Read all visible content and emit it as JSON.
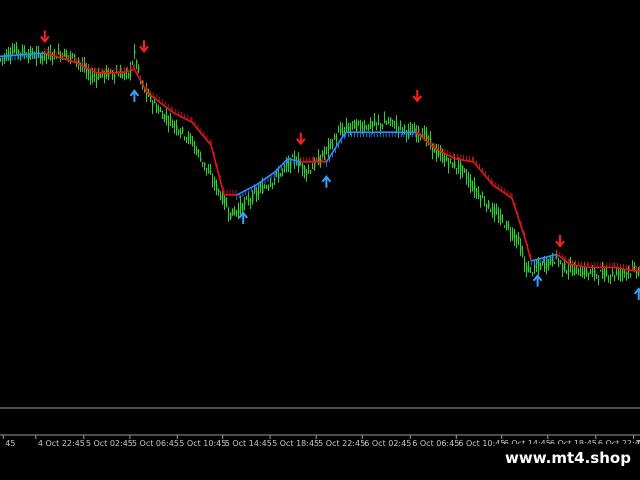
{
  "chart_data": {
    "type": "candlestick",
    "background": "#000000",
    "colors": {
      "candle": "#32cd32",
      "trend_down": "#e8141e",
      "trend_up": "#2a8cff",
      "sell_arrow": "#ff2020",
      "buy_arrow": "#3aa0ff",
      "axis": "#9a9a9a",
      "text": "#c8c8c8"
    },
    "y_range": [
      0,
      100
    ],
    "x_range": [
      0,
      100
    ],
    "x_ticks": [
      {
        "x": 0.5,
        "label": "45"
      },
      {
        "x": 5.6,
        "label": "4 Oct 22:45"
      },
      {
        "x": 13.1,
        "label": "5 Oct 02:45"
      },
      {
        "x": 20.3,
        "label": "5 Oct 06:45"
      },
      {
        "x": 27.7,
        "label": "5 Oct 10:45"
      },
      {
        "x": 34.8,
        "label": "5 Oct 14:45"
      },
      {
        "x": 42.2,
        "label": "5 Oct 18:45"
      },
      {
        "x": 49.4,
        "label": "5 Oct 22:45"
      },
      {
        "x": 56.6,
        "label": "6 Oct 02:45"
      },
      {
        "x": 64.1,
        "label": "6 Oct 06:45"
      },
      {
        "x": 71.3,
        "label": "6 Oct 10:45"
      },
      {
        "x": 78.4,
        "label": "6 Oct 14:45"
      },
      {
        "x": 85.6,
        "label": "6 Oct 18:45"
      },
      {
        "x": 93.1,
        "label": "6 Oct 22:45"
      },
      {
        "x": 99.0,
        "label": "7 Oc"
      }
    ],
    "price_path": [
      [
        0,
        88
      ],
      [
        2,
        91
      ],
      [
        6,
        89
      ],
      [
        10,
        90
      ],
      [
        12,
        88
      ],
      [
        14,
        83
      ],
      [
        18,
        84
      ],
      [
        20,
        83
      ],
      [
        21,
        90
      ],
      [
        22,
        80
      ],
      [
        25,
        72
      ],
      [
        28,
        67
      ],
      [
        30,
        63
      ],
      [
        33,
        52
      ],
      [
        35,
        45
      ],
      [
        36,
        41
      ],
      [
        38,
        44
      ],
      [
        41,
        49
      ],
      [
        44,
        54
      ],
      [
        46,
        58
      ],
      [
        48,
        54
      ],
      [
        50,
        58
      ],
      [
        53,
        66
      ],
      [
        55,
        68
      ],
      [
        58,
        68
      ],
      [
        61,
        69
      ],
      [
        64,
        66
      ],
      [
        66,
        66
      ],
      [
        68,
        60
      ],
      [
        70,
        57
      ],
      [
        72,
        55
      ],
      [
        74,
        49
      ],
      [
        77,
        42
      ],
      [
        79,
        38
      ],
      [
        81,
        33
      ],
      [
        82,
        25
      ],
      [
        83,
        24
      ],
      [
        85,
        26
      ],
      [
        87,
        28
      ],
      [
        88,
        25
      ],
      [
        90,
        24
      ],
      [
        93,
        23
      ],
      [
        96,
        23
      ],
      [
        98,
        24
      ],
      [
        100,
        24
      ]
    ],
    "trend_line": [
      {
        "x": 0,
        "y": 89,
        "trend": "up"
      },
      {
        "x": 7,
        "y": 90,
        "trend": "down"
      },
      {
        "x": 12,
        "y": 87,
        "trend": "down"
      },
      {
        "x": 15,
        "y": 84,
        "trend": "down"
      },
      {
        "x": 19,
        "y": 84,
        "trend": "down"
      },
      {
        "x": 21,
        "y": 85,
        "trend": "down"
      },
      {
        "x": 23,
        "y": 78,
        "trend": "down"
      },
      {
        "x": 27,
        "y": 72,
        "trend": "down"
      },
      {
        "x": 30,
        "y": 69,
        "trend": "down"
      },
      {
        "x": 33,
        "y": 62,
        "trend": "down"
      },
      {
        "x": 35,
        "y": 47,
        "trend": "down"
      },
      {
        "x": 37,
        "y": 47,
        "trend": "up"
      },
      {
        "x": 40,
        "y": 50,
        "trend": "up"
      },
      {
        "x": 43,
        "y": 54,
        "trend": "up"
      },
      {
        "x": 45,
        "y": 58,
        "trend": "up"
      },
      {
        "x": 47,
        "y": 57,
        "trend": "down"
      },
      {
        "x": 49,
        "y": 57,
        "trend": "down"
      },
      {
        "x": 51,
        "y": 57,
        "trend": "up"
      },
      {
        "x": 54,
        "y": 66,
        "trend": "up"
      },
      {
        "x": 58,
        "y": 66,
        "trend": "up"
      },
      {
        "x": 63,
        "y": 66,
        "trend": "up"
      },
      {
        "x": 65,
        "y": 66,
        "trend": "down"
      },
      {
        "x": 68,
        "y": 61,
        "trend": "down"
      },
      {
        "x": 71,
        "y": 58,
        "trend": "down"
      },
      {
        "x": 74,
        "y": 57,
        "trend": "down"
      },
      {
        "x": 77,
        "y": 50,
        "trend": "down"
      },
      {
        "x": 80,
        "y": 46,
        "trend": "down"
      },
      {
        "x": 82,
        "y": 34,
        "trend": "down"
      },
      {
        "x": 83,
        "y": 27,
        "trend": "up"
      },
      {
        "x": 85,
        "y": 28,
        "trend": "up"
      },
      {
        "x": 87,
        "y": 29,
        "trend": "down"
      },
      {
        "x": 89,
        "y": 26,
        "trend": "down"
      },
      {
        "x": 92,
        "y": 25,
        "trend": "down"
      },
      {
        "x": 96,
        "y": 25,
        "trend": "down"
      },
      {
        "x": 99,
        "y": 24,
        "trend": "down"
      },
      {
        "x": 100,
        "y": 24,
        "trend": "up"
      }
    ],
    "signals": [
      {
        "type": "sell",
        "x": 7.0,
        "y": 95
      },
      {
        "type": "sell",
        "x": 22.5,
        "y": 92
      },
      {
        "type": "buy",
        "x": 21.0,
        "y": 77
      },
      {
        "type": "buy",
        "x": 38.0,
        "y": 40
      },
      {
        "type": "sell",
        "x": 47.0,
        "y": 64
      },
      {
        "type": "buy",
        "x": 51.0,
        "y": 51
      },
      {
        "type": "sell",
        "x": 65.2,
        "y": 77
      },
      {
        "type": "buy",
        "x": 84.0,
        "y": 21
      },
      {
        "type": "sell",
        "x": 87.5,
        "y": 33
      },
      {
        "type": "buy",
        "x": 99.8,
        "y": 17
      }
    ]
  },
  "watermark": {
    "text": "www.mt4.shop"
  }
}
